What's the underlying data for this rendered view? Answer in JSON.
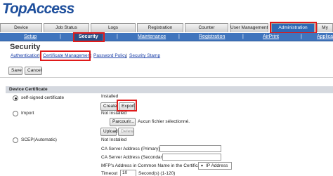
{
  "brand": {
    "logo_text": "TopAccess"
  },
  "main_tabs": [
    {
      "label": "Device"
    },
    {
      "label": "Job Status"
    },
    {
      "label": "Logs"
    },
    {
      "label": "Registration"
    },
    {
      "label": "Counter"
    },
    {
      "label": "User Management"
    },
    {
      "label": "Administration"
    },
    {
      "label": "My"
    }
  ],
  "sub_nav": [
    {
      "label": "Setup"
    },
    {
      "label": "Security"
    },
    {
      "label": "Maintenance"
    },
    {
      "label": "Registration"
    },
    {
      "label": "AirPrint"
    },
    {
      "label": "Applica"
    }
  ],
  "sub_nav_separator": "|",
  "page_title": "Security",
  "security_tabs": [
    {
      "label": "Authentication"
    },
    {
      "label": "Certificate Management"
    },
    {
      "label": "Password Policy"
    },
    {
      "label": "Security Stamp"
    }
  ],
  "security_tab_separator": "|",
  "actions": {
    "save": "Save",
    "cancel": "Cancel"
  },
  "device_certificate": {
    "header": "Device Certificate",
    "options": [
      {
        "label": "self-signed certificate",
        "status": "Installed",
        "selected": true
      },
      {
        "label": "Import",
        "status": "Not Installed",
        "selected": false
      },
      {
        "label": "SCEP(Automatic)",
        "status": "Not Installed",
        "selected": false
      }
    ],
    "create_button": "Create",
    "export_button": "Export",
    "browse_button": "Parcourir...",
    "no_file_text": "Aucun fichier sélectionné.",
    "upload_button": "Upload",
    "delete_button": "Delete",
    "scep_fields": {
      "ca_primary_label": "CA Server Address (Primary) :",
      "ca_secondary_label": "CA Server Address (Secondary) :",
      "mfp_address_label": "MFP's Address in Common Name in the Certificate :",
      "mfp_address_value": "IP Address",
      "timeout_label": "Timeout",
      "timeout_value": "10",
      "timeout_unit": "Second(s) (1-120)"
    }
  },
  "colors": {
    "brand_blue": "#1e4f9c",
    "nav_blue": "#3f74bd",
    "highlight_red": "#e01a1a"
  }
}
